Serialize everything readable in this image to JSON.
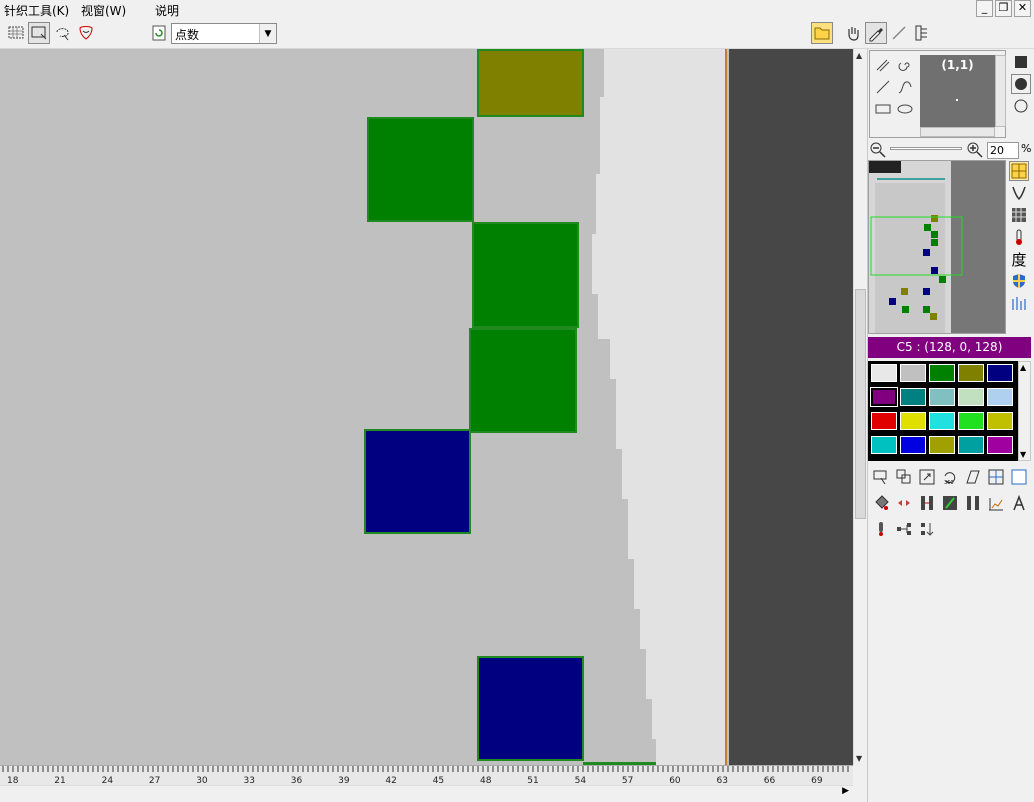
{
  "menu": {
    "knit_tools": "针织工具(K)",
    "window": "视窗(W)",
    "help": "说明"
  },
  "window_controls": {
    "minimize": "_",
    "restore": "❐",
    "close": "✕"
  },
  "toolbar": {
    "mode_value": "点数"
  },
  "navigator": {
    "coord": "(1,1)",
    "zoom": "20",
    "zoom_unit": "%"
  },
  "current_color": {
    "label": "C5 : (128, 0, 128)",
    "hex": "#800080"
  },
  "palette": [
    "#e8e8e8",
    "#c0c0c0",
    "#008000",
    "#808000",
    "#000080",
    "#800080",
    "#008080",
    "#80c0c0",
    "#c0e0c0",
    "#b0d0f0",
    "#e00000",
    "#e0e000",
    "#20e0e0",
    "#20e020",
    "#c0c000",
    "#00c0c0",
    "#0000e0",
    "#a0a000",
    "#00a0a0",
    "#a000a0"
  ],
  "ruler": {
    "ticks": [
      "18",
      "21",
      "24",
      "27",
      "30",
      "33",
      "36",
      "39",
      "42",
      "45",
      "48",
      "51",
      "54",
      "57",
      "60",
      "63",
      "66",
      "69"
    ]
  },
  "canvas_blocks": [
    {
      "color": "#808000"
    },
    {
      "color": "#008000"
    },
    {
      "color": "#008000"
    },
    {
      "color": "#008000"
    },
    {
      "color": "#000080"
    },
    {
      "color": "#000080"
    }
  ]
}
